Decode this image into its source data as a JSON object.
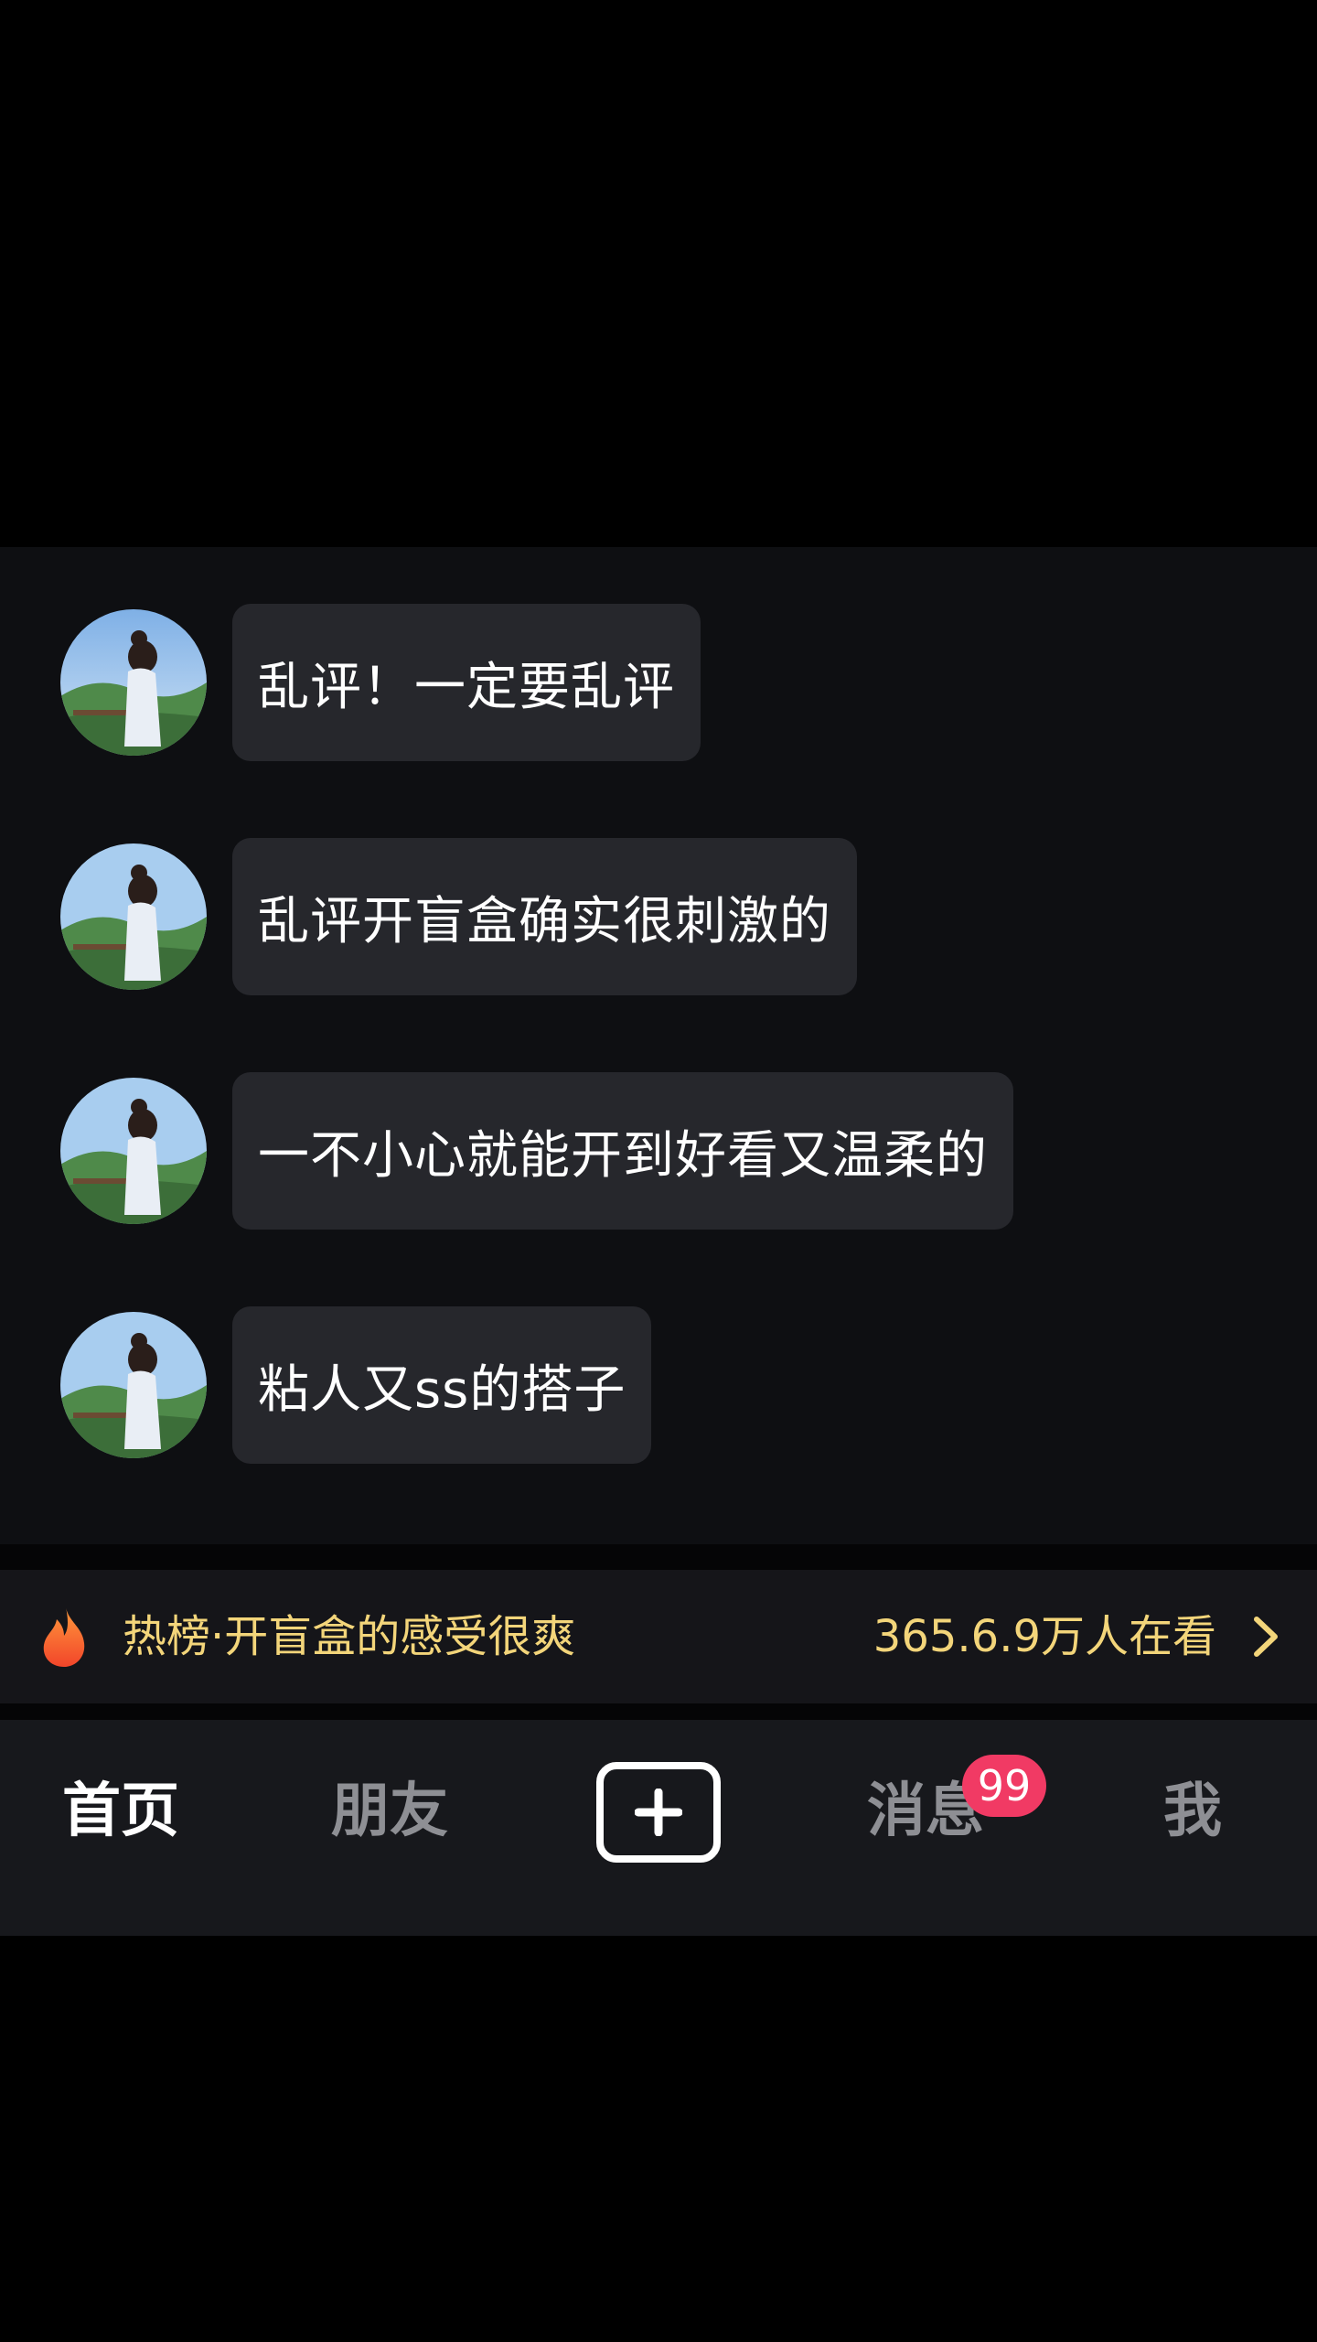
{
  "messages": [
    {
      "text": "乱评！一定要乱评"
    },
    {
      "text": "乱评开盲盒确实很刺激的"
    },
    {
      "text": "一不小心就能开到好看又温柔的"
    },
    {
      "text": "粘人又ss的搭子"
    }
  ],
  "hot_bar": {
    "title": "热榜·开盲盒的感受很爽",
    "viewers": "365.6.9万人在看",
    "icon": "flame-icon",
    "chevron": "chevron-right-icon"
  },
  "tab_bar": {
    "home": "首页",
    "friends": "朋友",
    "create_icon": "plus-icon",
    "messages": "消息",
    "messages_badge": "99",
    "me": "我"
  },
  "colors": {
    "bubble": "#26272c",
    "hot_text": "#f3d57a",
    "badge": "#f13a64"
  }
}
